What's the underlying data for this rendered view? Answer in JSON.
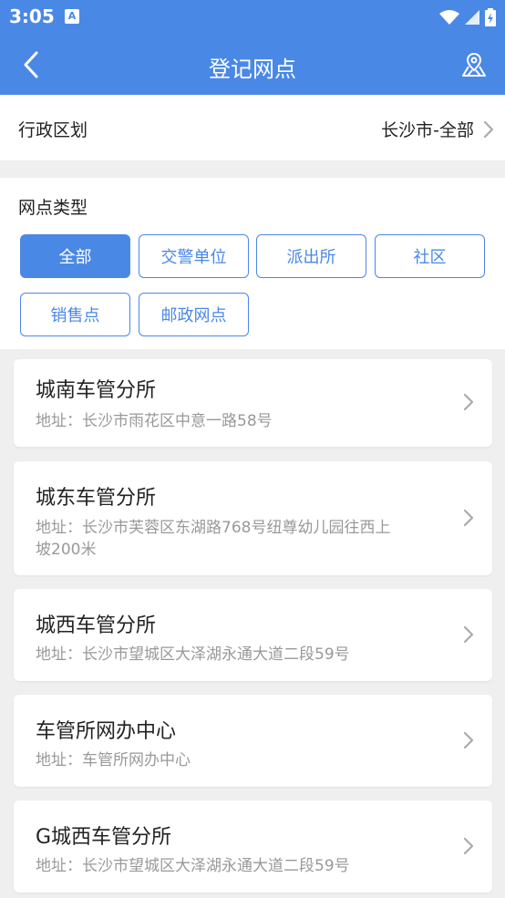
{
  "status_bar": {
    "time": "3:05",
    "notification_glyph": "A"
  },
  "app_bar": {
    "title": "登记网点"
  },
  "region": {
    "label": "行政区划",
    "value": "长沙市-全部"
  },
  "types": {
    "label": "网点类型",
    "chips": [
      "全部",
      "交警单位",
      "派出所",
      "社区",
      "销售点",
      "邮政网点"
    ],
    "selected": "全部"
  },
  "locations": [
    {
      "name": "城南车管分所",
      "address": "地址：长沙市雨花区中意一路58号"
    },
    {
      "name": "城东车管分所",
      "address_line1": "地址：长沙市芙蓉区东湖路768号纽尊幼儿园往西上",
      "address_line2": "坡200米"
    },
    {
      "name": "城西车管分所",
      "address": "地址：长沙市望城区大泽湖永通大道二段59号"
    },
    {
      "name": "车管所网办中心",
      "address": "地址：车管所网办中心"
    },
    {
      "name": "G城西车管分所",
      "address": "地址：长沙市望城区大泽湖永通大道二段59号"
    }
  ],
  "colors": {
    "primary": "#4a88e6",
    "background": "#efefef",
    "muted_text": "#999999"
  }
}
